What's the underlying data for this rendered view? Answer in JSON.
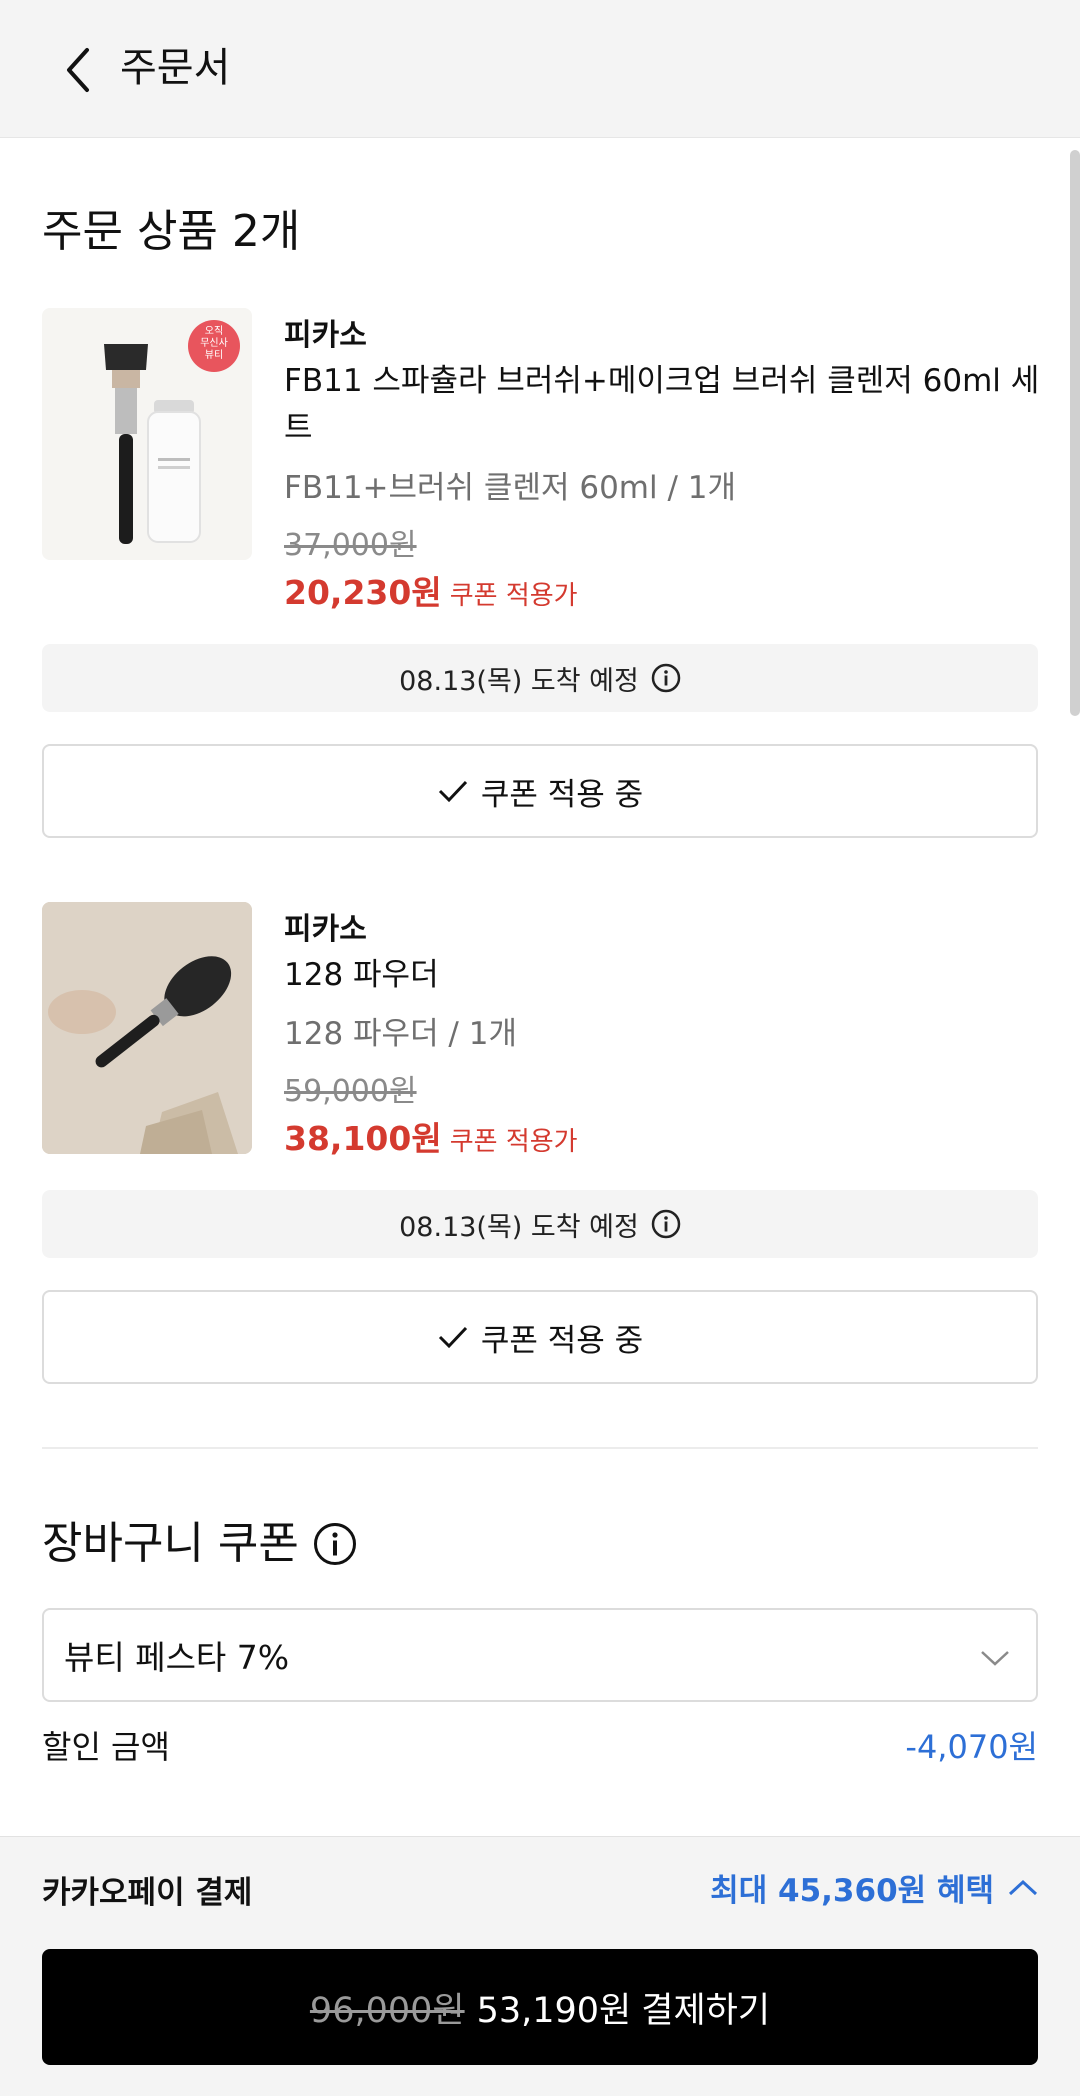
{
  "header": {
    "title": "주문서",
    "back_icon": "chevron-left-icon"
  },
  "order": {
    "title": "주문 상품 2개",
    "items": [
      {
        "brand": "피카소",
        "name_line1": "FB11 스파츌라 브러쉬+메이크업 브러쉬 클렌저 60ml 세",
        "name_line2": "트",
        "option": "FB11+브러쉬 클렌저 60ml / 1개",
        "original_price": "37,000원",
        "sale_price": "20,230원",
        "sale_label": "쿠폰 적용가",
        "delivery": "08.13(목) 도착 예정",
        "coupon_button": "쿠폰 적용 중",
        "thumb_badge": [
          "오직",
          "무신사",
          "뷰티"
        ]
      },
      {
        "brand": "피카소",
        "name_line1": "128 파우더",
        "option": "128 파우더 / 1개",
        "original_price": "59,000원",
        "sale_price": "38,100원",
        "sale_label": "쿠폰 적용가",
        "delivery": "08.13(목) 도착 예정",
        "coupon_button": "쿠폰 적용 중"
      }
    ]
  },
  "cart_coupon": {
    "title": "장바구니 쿠폰",
    "selected": "뷰티 페스타 7%",
    "discount_label": "할인 금액",
    "discount_value": "-4,070원"
  },
  "payment": {
    "method": "카카오페이 결제",
    "benefit": "최대 45,360원 혜택",
    "original_total": "96,000원",
    "total": "53,190원",
    "action": "결제하기"
  },
  "colors": {
    "sale": "#d43a2f",
    "link": "#2d6fd6",
    "primary_button": "#000000"
  }
}
